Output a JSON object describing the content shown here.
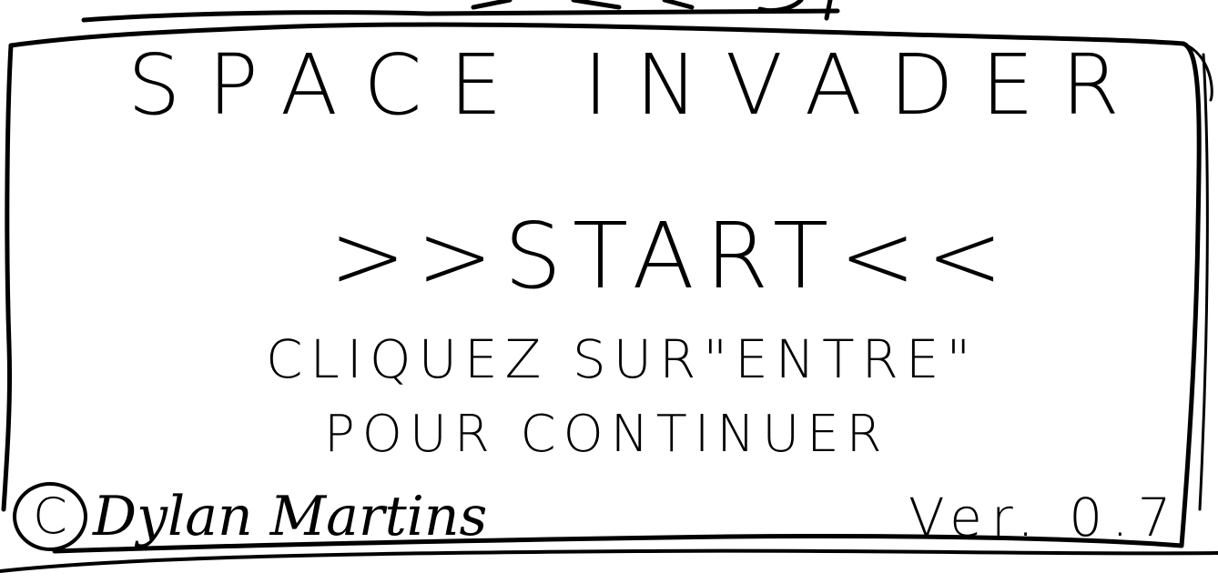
{
  "screen": {
    "title": "SPACE INVADER",
    "start_label": ">>START<<",
    "instruction_line1": "CLIQUEZ SUR\"ENTRE\"",
    "instruction_line2": "POUR CONTINUER",
    "copyright_symbol": "C",
    "copyright_name": "Dylan Martins",
    "version": "Ver. 0.7"
  }
}
